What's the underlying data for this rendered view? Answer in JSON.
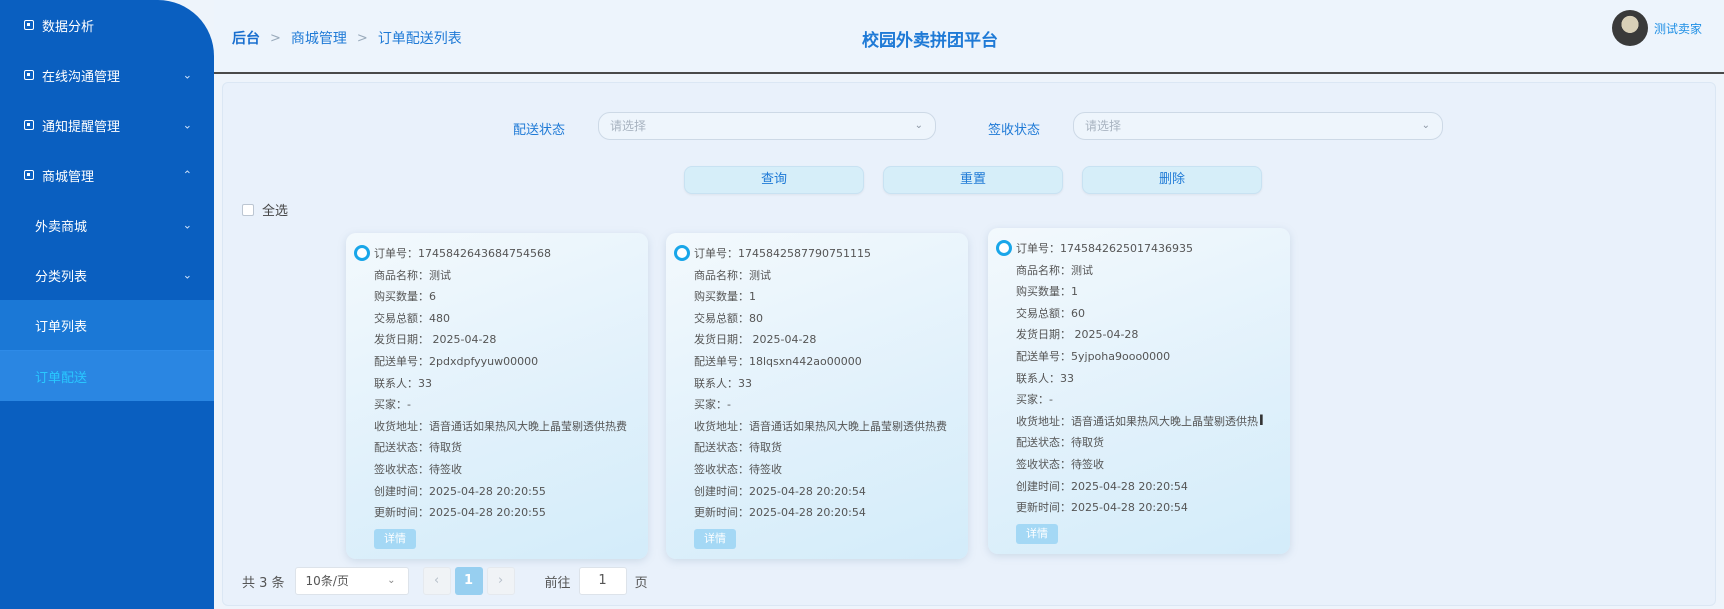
{
  "sidebar": {
    "items": [
      {
        "label": "数据分析",
        "arrow": ""
      },
      {
        "label": "在线沟通管理",
        "arrow": "⌄"
      },
      {
        "label": "通知提醒管理",
        "arrow": "⌄"
      },
      {
        "label": "商城管理",
        "arrow": "⌃"
      }
    ],
    "sub_items": [
      {
        "label": "外卖商城",
        "arrow": "⌄"
      },
      {
        "label": "分类列表",
        "arrow": "⌄"
      },
      {
        "label": "订单列表"
      },
      {
        "label": "订单配送"
      }
    ],
    "icon": "menu-item-icon"
  },
  "header": {
    "breadcrumb": [
      "后台",
      "商城管理",
      "订单配送列表"
    ],
    "separator": ">",
    "title": "校园外卖拼团平台",
    "username": "测试卖家"
  },
  "filters": {
    "delivery_label": "配送状态",
    "delivery_placeholder": "请选择",
    "sign_label": "签收状态",
    "sign_placeholder": "请选择"
  },
  "actions": {
    "query": "查询",
    "reset": "重置",
    "delete": "删除",
    "select_all": "全选"
  },
  "cards": [
    {
      "lines": [
        "订单号：1745842643684754568",
        "商品名称：测试",
        "购买数量：6",
        "交易总额：480",
        "发货日期：  2025-04-28",
        "配送单号：2pdxdpfyyuw00000",
        "联系人：33",
        "买家：-",
        "收货地址：语音通话如果热风大晚上晶莹剔透供热费",
        "配送状态：待取货",
        "签收状态：待签收",
        "创建时间：2025-04-28 20:20:55",
        "更新时间：2025-04-28 20:20:55"
      ],
      "detail": "详情"
    },
    {
      "lines": [
        "订单号：1745842587790751115",
        "商品名称：测试",
        "购买数量：1",
        "交易总额：80",
        "发货日期：  2025-04-28",
        "配送单号：18lqsxn442ao00000",
        "联系人：33",
        "买家：-",
        "收货地址：语音通话如果热风大晚上晶莹剔透供热费",
        "配送状态：待取货",
        "签收状态：待签收",
        "创建时间：2025-04-28 20:20:54",
        "更新时间：2025-04-28 20:20:54"
      ],
      "detail": "详情"
    },
    {
      "lines": [
        "订单号：1745842625017436935",
        "商品名称：测试",
        "购买数量：1",
        "交易总额：60",
        "发货日期：  2025-04-28",
        "配送单号：5yjpoha9ooo0000",
        "联系人：33",
        "买家：-",
        "收货地址：语音通话如果热风大晚上晶莹剔透供热",
        "配送状态：待取货",
        "签收状态：待签收",
        "创建时间：2025-04-28 20:20:54",
        "更新时间：2025-04-28 20:20:54"
      ],
      "detail": "详情"
    }
  ],
  "pagination": {
    "total_text": "共 3 条",
    "page_size": "10条/页",
    "prev": "‹",
    "current_page": "1",
    "next": "›",
    "goto_label": "前往",
    "goto_value": "1",
    "page_suffix": "页"
  }
}
